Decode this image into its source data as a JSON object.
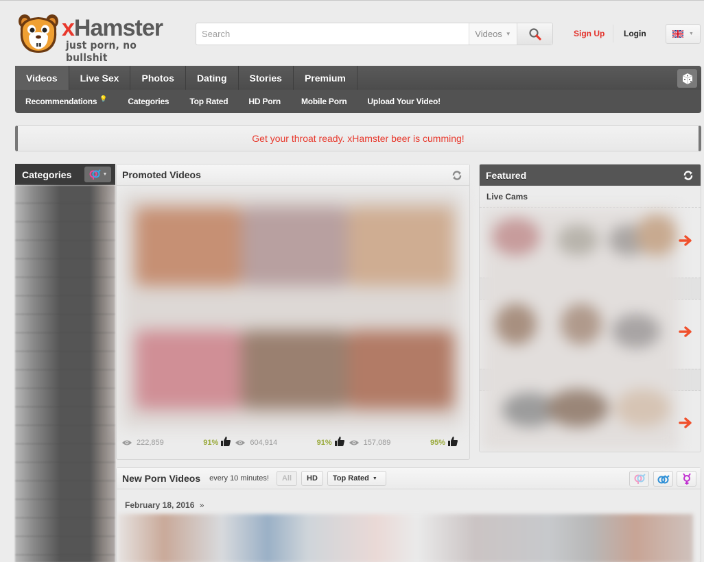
{
  "header": {
    "brand_x": "x",
    "brand_rest": "Hamster",
    "tagline": "just porn, no bullshit",
    "search": {
      "placeholder": "Search",
      "scope": "Videos"
    },
    "signup": "Sign Up",
    "login": "Login",
    "language": "English (UK flag)"
  },
  "nav": {
    "tabs": [
      {
        "label": "Videos",
        "active": true
      },
      {
        "label": "Live Sex"
      },
      {
        "label": "Photos"
      },
      {
        "label": "Dating"
      },
      {
        "label": "Stories"
      },
      {
        "label": "Premium"
      }
    ],
    "subnav": [
      {
        "label": "Recommendations"
      },
      {
        "label": "Categories"
      },
      {
        "label": "Top Rated"
      },
      {
        "label": "HD Porn"
      },
      {
        "label": "Mobile Porn"
      },
      {
        "label": "Upload Your Video!"
      }
    ]
  },
  "banner": {
    "text": "Get your throat ready. xHamster beer is cumming!"
  },
  "categories": {
    "title": "Categories"
  },
  "promoted": {
    "title": "Promoted Videos",
    "videos": [
      {
        "views": "222,859",
        "rating": "91%"
      },
      {
        "views": "604,914",
        "rating": "91%"
      },
      {
        "views": "157,089",
        "rating": "95%"
      }
    ]
  },
  "featured": {
    "title": "Featured",
    "subtitle": "Live Cams"
  },
  "new_videos": {
    "title": "New Porn Videos",
    "subtitle": "every 10 minutes!",
    "filters": {
      "all": "All",
      "hd": "HD",
      "sort": "Top Rated"
    },
    "date": "February 18, 2016",
    "date_suffix": "»"
  },
  "colors": {
    "accent_red": "#e8382c",
    "rating_green": "#9aaa3c",
    "nav_dark": "#525252"
  }
}
